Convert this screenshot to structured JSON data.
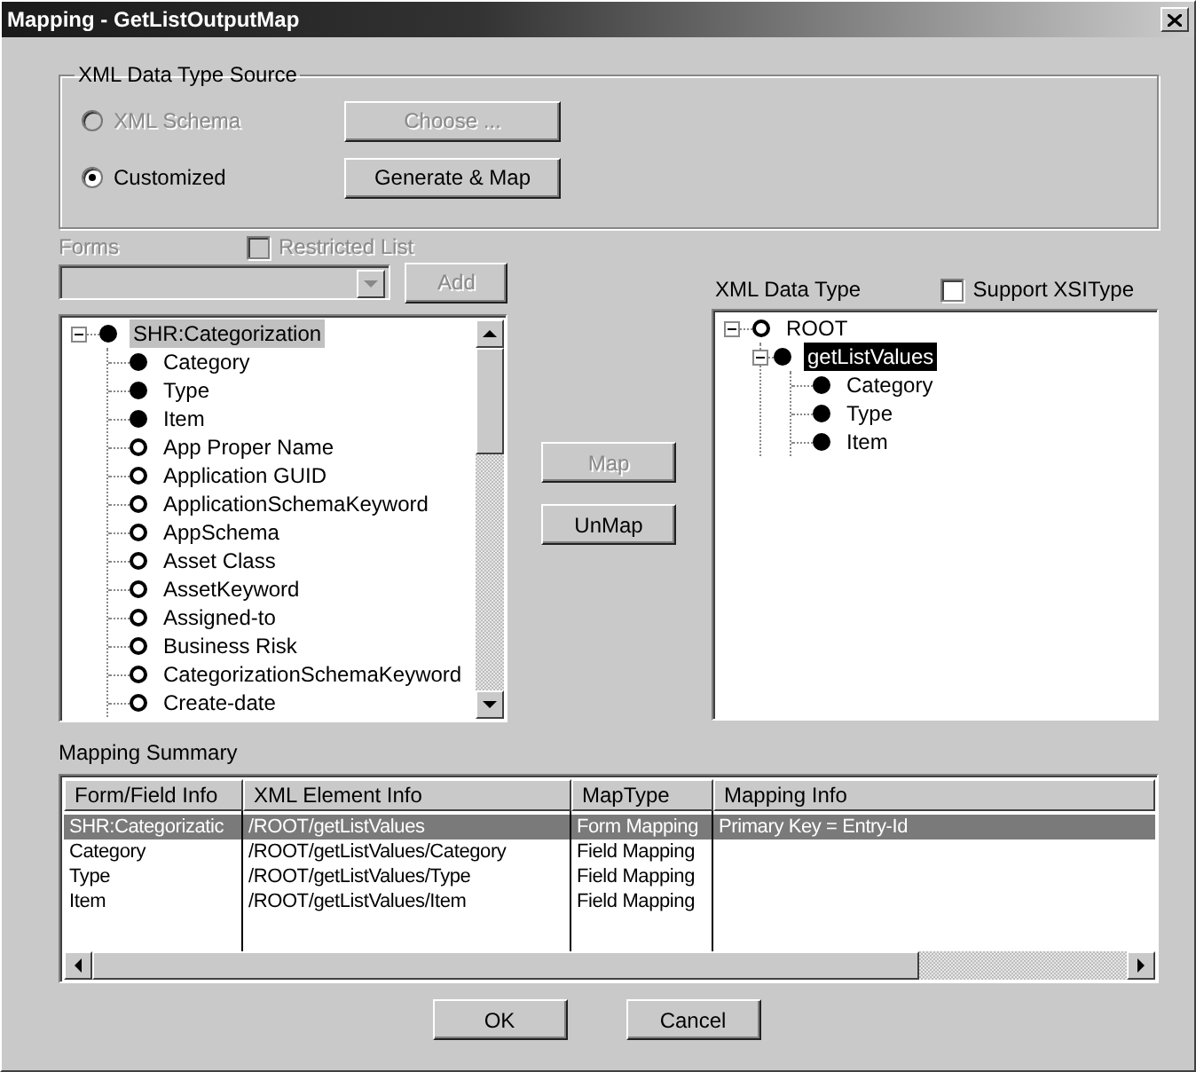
{
  "window": {
    "title": "Mapping - GetListOutputMap"
  },
  "source_group": {
    "title": "XML Data Type Source",
    "options": [
      {
        "label": "XML Schema",
        "selected": false,
        "disabled": true,
        "button": {
          "label": "Choose ...",
          "disabled": true
        }
      },
      {
        "label": "Customized",
        "selected": true,
        "disabled": false,
        "button": {
          "label": "Generate & Map",
          "disabled": false
        }
      }
    ]
  },
  "forms": {
    "label": "Forms",
    "disabled": true,
    "restricted_list": {
      "label": "Restricted List",
      "checked": false,
      "disabled": true
    },
    "add_button": {
      "label": "Add",
      "disabled": true
    }
  },
  "form_tree": {
    "focused": false,
    "root": {
      "label": "SHR:Categorization",
      "mapped": true,
      "expanded": true,
      "selected": true,
      "children": [
        {
          "label": "Category",
          "mapped": true,
          "selected": false
        },
        {
          "label": "Type",
          "mapped": true,
          "selected": false
        },
        {
          "label": "Item",
          "mapped": true,
          "selected": false
        },
        {
          "label": "App Proper Name",
          "mapped": false,
          "selected": false
        },
        {
          "label": "Application GUID",
          "mapped": false,
          "selected": false
        },
        {
          "label": "ApplicationSchemaKeyword",
          "mapped": false,
          "selected": false
        },
        {
          "label": "AppSchema",
          "mapped": false,
          "selected": false
        },
        {
          "label": "Asset Class",
          "mapped": false,
          "selected": false
        },
        {
          "label": "AssetKeyword",
          "mapped": false,
          "selected": false
        },
        {
          "label": "Assigned-to",
          "mapped": false,
          "selected": false
        },
        {
          "label": "Business Risk",
          "mapped": false,
          "selected": false
        },
        {
          "label": "CategorizationSchemaKeyword",
          "mapped": false,
          "selected": false
        },
        {
          "label": "Create-date",
          "mapped": false,
          "selected": false
        }
      ]
    }
  },
  "map_buttons": [
    {
      "label": "Map",
      "disabled": true
    },
    {
      "label": "UnMap",
      "disabled": false
    }
  ],
  "xml_tree": {
    "label": "XML Data Type",
    "support_xsitype": {
      "label": "Support XSIType",
      "checked": false
    },
    "focused": true,
    "root": {
      "label": "ROOT",
      "mapped": false,
      "expanded": true,
      "selected": false,
      "children": [
        {
          "label": "getListValues",
          "mapped": true,
          "expanded": true,
          "selected": true,
          "children": [
            {
              "label": "Category",
              "mapped": true,
              "selected": false
            },
            {
              "label": "Type",
              "mapped": true,
              "selected": false
            },
            {
              "label": "Item",
              "mapped": true,
              "selected": false
            }
          ]
        }
      ]
    }
  },
  "summary": {
    "label": "Mapping Summary",
    "columns": [
      "Form/Field Info",
      "XML Element Info",
      "MapType",
      "Mapping Info"
    ],
    "rows": [
      {
        "selected": true,
        "cells": [
          "SHR:Categorizatic",
          "/ROOT/getListValues",
          "Form Mapping",
          "Primary Key = Entry-Id"
        ]
      },
      {
        "selected": false,
        "cells": [
          "Category",
          "/ROOT/getListValues/Category",
          "Field Mapping",
          ""
        ]
      },
      {
        "selected": false,
        "cells": [
          "Type",
          "/ROOT/getListValues/Type",
          "Field Mapping",
          ""
        ]
      },
      {
        "selected": false,
        "cells": [
          "Item",
          "/ROOT/getListValues/Item",
          "Field Mapping",
          ""
        ]
      }
    ]
  },
  "buttons": [
    {
      "label": "OK"
    },
    {
      "label": "Cancel"
    }
  ]
}
